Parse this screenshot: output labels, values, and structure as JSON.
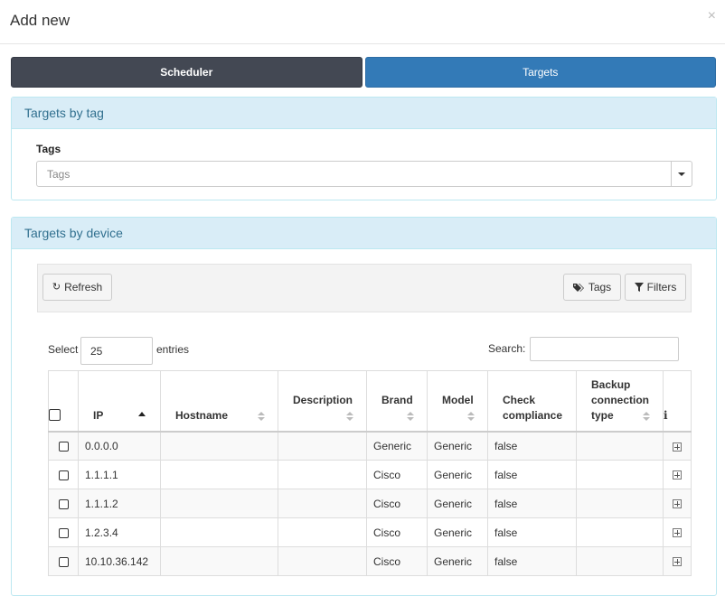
{
  "modal": {
    "title": "Add new",
    "close_symbol": "×"
  },
  "tabs": [
    {
      "label": "Scheduler",
      "active": false
    },
    {
      "label": "Targets",
      "active": true
    }
  ],
  "targets_by_tag": {
    "heading": "Targets by tag",
    "tags_label": "Tags",
    "tags_placeholder": "Tags"
  },
  "targets_by_device": {
    "heading": "Targets by device",
    "toolbar": {
      "refresh_label": "Refresh",
      "tags_label": "Tags",
      "filters_label": "Filters"
    },
    "length": {
      "prefix": "Select",
      "value": "25",
      "suffix": "entries"
    },
    "search": {
      "label": "Search:",
      "value": ""
    },
    "columns": {
      "ip": "IP",
      "hostname": "Hostname",
      "description": "Description",
      "brand": "Brand",
      "model": "Model",
      "check_compliance_1": "Check",
      "check_compliance_2": "compliance",
      "backup_1": "Backup",
      "backup_2": "connection",
      "backup_3": "type",
      "info": "i"
    },
    "sort": {
      "column": "IP",
      "direction": "asc"
    },
    "rows": [
      {
        "ip": "0.0.0.0",
        "hostname": "",
        "description": "",
        "brand": "Generic",
        "model": "Generic",
        "check_compliance": "false",
        "backup_type": ""
      },
      {
        "ip": "1.1.1.1",
        "hostname": "",
        "description": "",
        "brand": "Cisco",
        "model": "Generic",
        "check_compliance": "false",
        "backup_type": ""
      },
      {
        "ip": "1.1.1.2",
        "hostname": "",
        "description": "",
        "brand": "Cisco",
        "model": "Generic",
        "check_compliance": "false",
        "backup_type": ""
      },
      {
        "ip": "1.2.3.4",
        "hostname": "",
        "description": "",
        "brand": "Cisco",
        "model": "Generic",
        "check_compliance": "false",
        "backup_type": ""
      },
      {
        "ip": "10.10.36.142",
        "hostname": "",
        "description": "",
        "brand": "Cisco",
        "model": "Generic",
        "check_compliance": "false",
        "backup_type": ""
      }
    ]
  },
  "colors": {
    "tab_scheduler": "#434853",
    "tab_targets": "#337ab7",
    "panel_heading_bg": "#d9edf7",
    "panel_heading_text": "#31708f"
  },
  "icons": {
    "close": "close-icon",
    "caret": "caret-down-icon",
    "refresh": "refresh-icon",
    "tag": "tags-icon",
    "filter": "filter-icon",
    "info": "info-icon",
    "expand": "plus-square-icon"
  }
}
